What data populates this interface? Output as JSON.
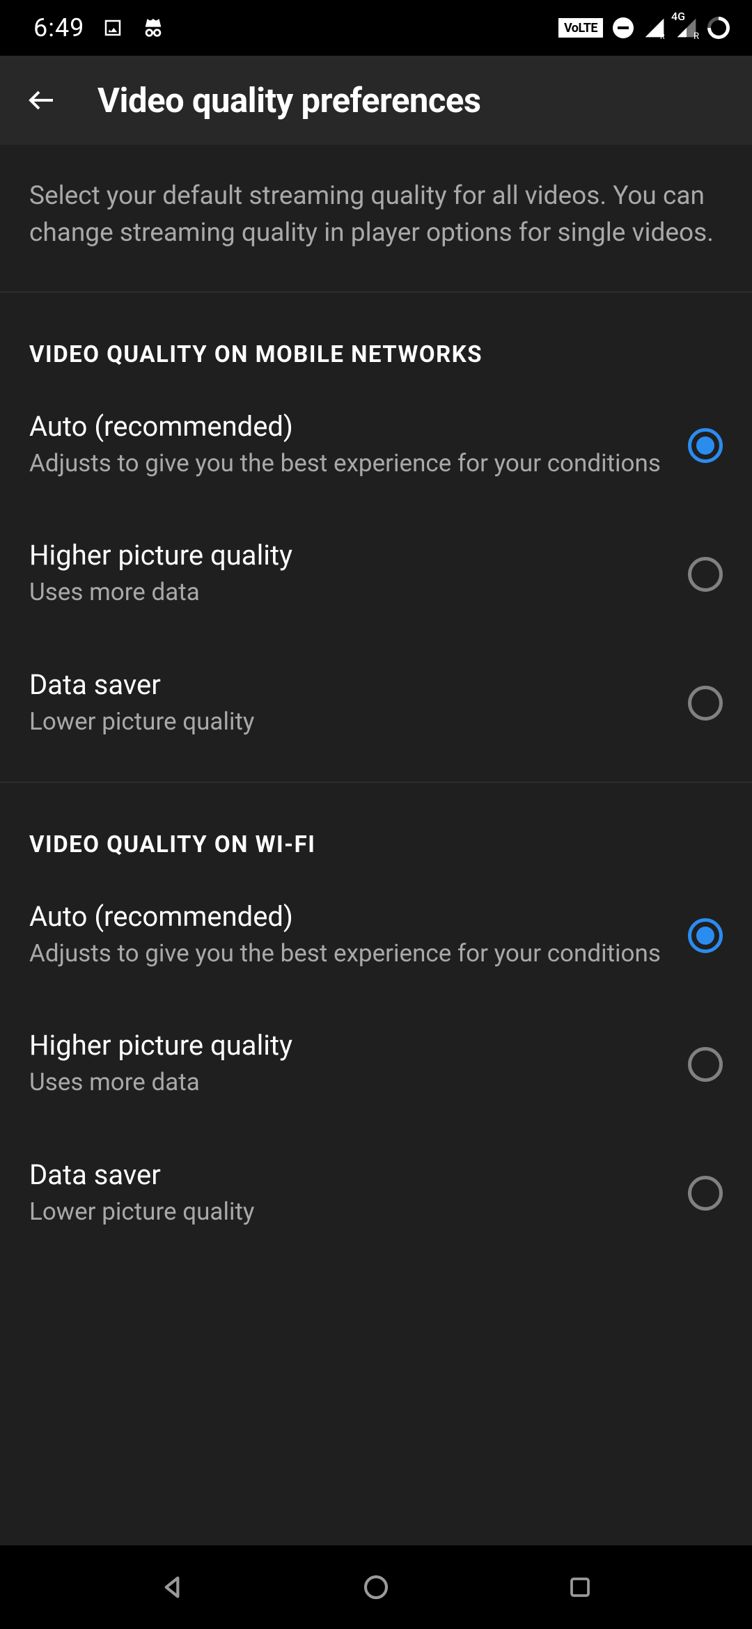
{
  "status": {
    "time": "6:49",
    "volte": "VoLTE"
  },
  "header": {
    "title": "Video quality preferences"
  },
  "description": "Select your default streaming quality for all videos. You can change streaming quality in player options for single videos.",
  "sections": {
    "mobile": {
      "header": "VIDEO QUALITY ON MOBILE NETWORKS",
      "options": [
        {
          "title": "Auto (recommended)",
          "subtitle": "Adjusts to give you the best experience for your conditions",
          "selected": true
        },
        {
          "title": "Higher picture quality",
          "subtitle": "Uses more data",
          "selected": false
        },
        {
          "title": "Data saver",
          "subtitle": "Lower picture quality",
          "selected": false
        }
      ]
    },
    "wifi": {
      "header": "VIDEO QUALITY ON WI-FI",
      "options": [
        {
          "title": "Auto (recommended)",
          "subtitle": "Adjusts to give you the best experience for your conditions",
          "selected": true
        },
        {
          "title": "Higher picture quality",
          "subtitle": "Uses more data",
          "selected": false
        },
        {
          "title": "Data saver",
          "subtitle": "Lower picture quality",
          "selected": false
        }
      ]
    }
  }
}
